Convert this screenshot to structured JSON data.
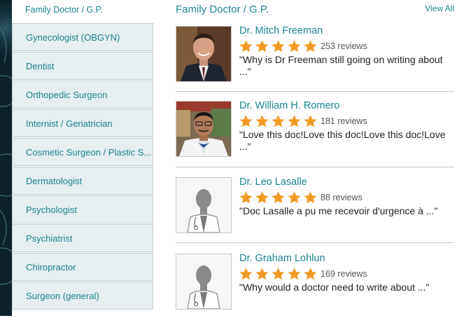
{
  "sidebar": {
    "items": [
      {
        "label": "Family Doctor / G.P."
      },
      {
        "label": "Gynecologist (OBGYN)"
      },
      {
        "label": "Dentist"
      },
      {
        "label": "Orthopedic Surgeon"
      },
      {
        "label": "Internist / Geriatrician"
      },
      {
        "label": "Cosmetic Surgeon / Plastic S..."
      },
      {
        "label": "Dermatologist"
      },
      {
        "label": "Psychologist"
      },
      {
        "label": "Psychiatrist"
      },
      {
        "label": "Chiropractor"
      },
      {
        "label": "Surgeon (general)"
      }
    ]
  },
  "main": {
    "title": "Family Doctor / G.P.",
    "view_all": "View All",
    "doctors": [
      {
        "name": "Dr. Mitch Freeman",
        "rating": 5,
        "reviews": "253 reviews",
        "quote": "\"Why is Dr Freeman still going on writing about ...\""
      },
      {
        "name": "Dr. William H. Romero",
        "rating": 5,
        "reviews": "181 reviews",
        "quote": "\"Love this doc!Love this doc!Love this doc!Love ...\""
      },
      {
        "name": "Dr. Leo Lasalle",
        "rating": 5,
        "reviews": "88 reviews",
        "quote": "\"Doc Lasalle a pu me recevoir d'urgence à ...\""
      },
      {
        "name": "Dr. Graham Lohlun",
        "rating": 5,
        "reviews": "169 reviews",
        "quote": "\"Why would a doctor need to write about ...\""
      }
    ]
  },
  "colors": {
    "accent": "#1e8390",
    "star": "#f39a25",
    "sidebar_bg": "#e6eeef"
  }
}
